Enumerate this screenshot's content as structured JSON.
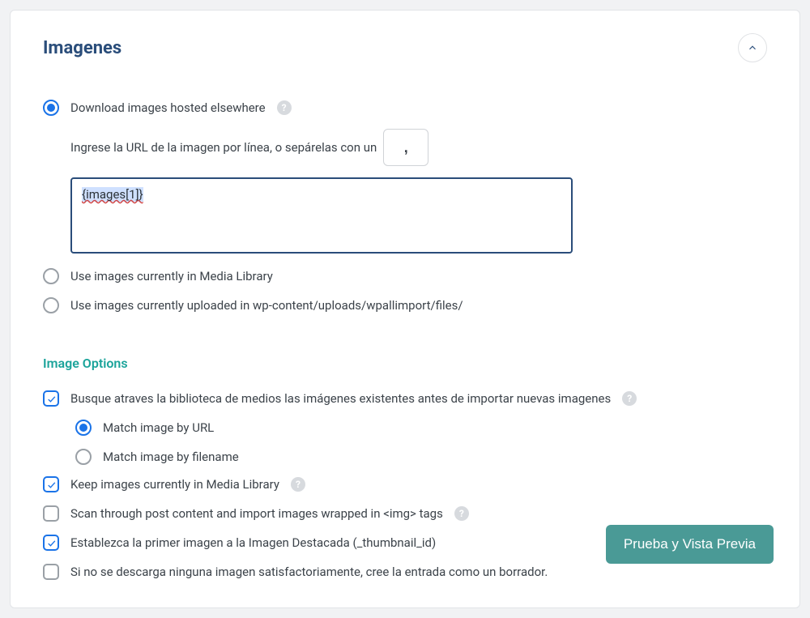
{
  "panel": {
    "title": "Imagenes"
  },
  "source": {
    "download": {
      "label": "Download images hosted elsewhere",
      "instruction": "Ingrese la URL de la imagen por línea, o sepárelas con un",
      "separator_value": ",",
      "textarea_value": "{images[1]}"
    },
    "media_library": {
      "label": "Use images currently in Media Library"
    },
    "uploads_dir": {
      "label": "Use images currently uploaded in wp-content/uploads/wpallimport/files/"
    }
  },
  "options": {
    "section_title": "Image Options",
    "search_existing": {
      "label": "Busque atraves la biblioteca de medios las imágenes existentes antes de importar nuevas imagenes",
      "match_by_url": "Match image by URL",
      "match_by_filename": "Match image by filename"
    },
    "keep_media": {
      "label": "Keep images currently in Media Library"
    },
    "scan_post": {
      "label": "Scan through post content and import images wrapped in <img> tags"
    },
    "set_featured": {
      "label": "Establezca la primer imagen a la Imagen Destacada (_thumbnail_id)"
    },
    "draft_on_fail": {
      "label": "Si no se descarga ninguna imagen satisfactoriamente, cree la entrada como un borrador."
    }
  },
  "footer": {
    "preview_button": "Prueba y Vista Previa"
  },
  "icons": {
    "help": "?"
  }
}
